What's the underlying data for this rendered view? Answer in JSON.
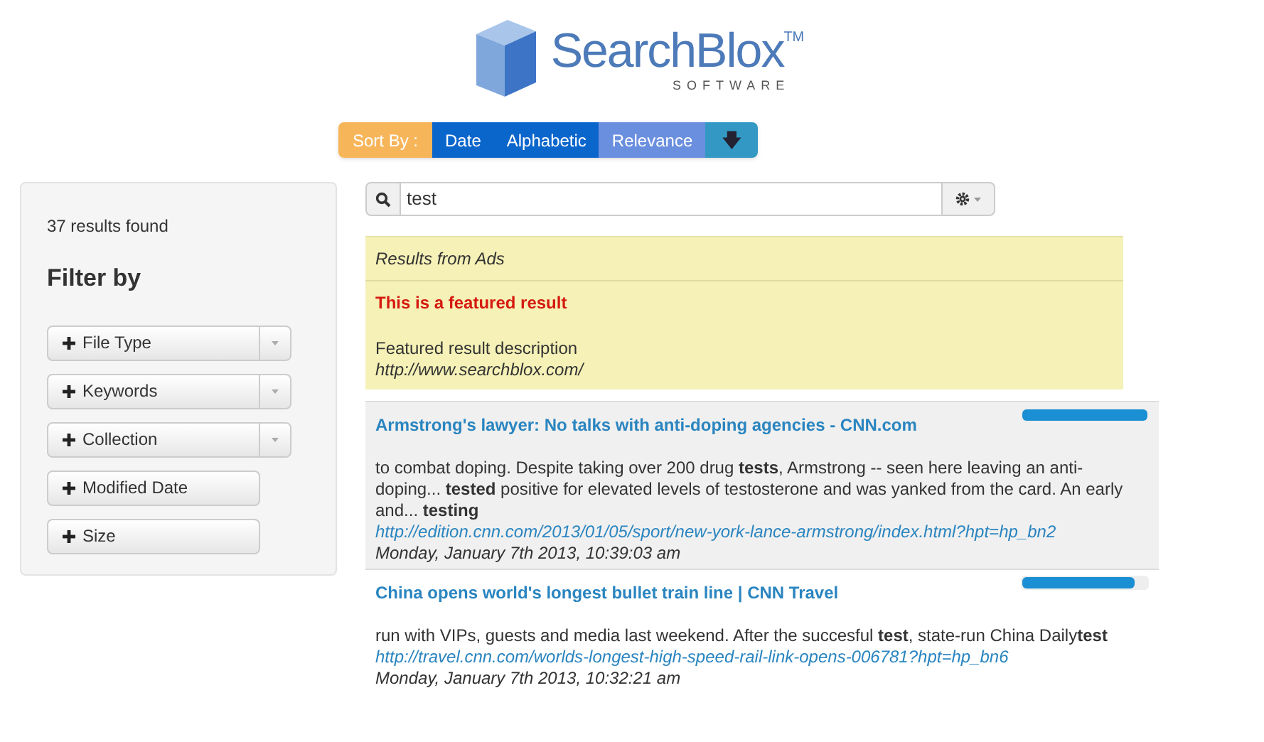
{
  "logo": {
    "name": "SearchBlox",
    "trademark": "TM",
    "tagline": "SOFTWARE"
  },
  "sort_bar": {
    "label": "Sort By :",
    "options": [
      {
        "label": "Date",
        "selected": false
      },
      {
        "label": "Alphabetic",
        "selected": false
      },
      {
        "label": "Relevance",
        "selected": true
      }
    ],
    "order_button": "🡇"
  },
  "sidebar": {
    "count": "37 results found",
    "heading": "Filter by",
    "filters": [
      {
        "label": "File Type",
        "has_dropdown": true
      },
      {
        "label": "Keywords",
        "has_dropdown": true
      },
      {
        "label": "Collection",
        "has_dropdown": true
      },
      {
        "label": "Modified Date",
        "has_dropdown": false
      },
      {
        "label": "Size",
        "has_dropdown": false
      }
    ]
  },
  "search": {
    "value": "test"
  },
  "ads": {
    "heading": "Results from Ads",
    "title": "This is a featured result",
    "description": "Featured result description",
    "url": "http://www.searchblox.com/"
  },
  "results": [
    {
      "title": "Armstrong's lawyer: No talks with anti-doping agencies - CNN.com",
      "highlighted": true,
      "level": 1.0,
      "snippet": "to combat doping. Despite taking over 200 drug **tests**, Armstrong -- seen here leaving an anti-doping... **tested** positive for elevated levels of testosterone and was yanked from the card. An early and... **testing**",
      "url": "http://edition.cnn.com/2013/01/05/sport/new-york-lance-armstrong/index.html?hpt=hp_bn2",
      "date": "Monday, January 7th 2013, 10:39:03 am"
    },
    {
      "title": "China opens world's longest bullet train line | CNN Travel",
      "highlighted": false,
      "level": 0.9,
      "snippet": "run with VIPs, guests and media last weekend. After the succesful **test**, state-run China Daily**test**",
      "url": "http://travel.cnn.com/worlds-longest-high-speed-rail-link-opens-006781?hpt=hp_bn6",
      "date": "Monday, January 7th 2013, 10:32:21 am"
    }
  ]
}
